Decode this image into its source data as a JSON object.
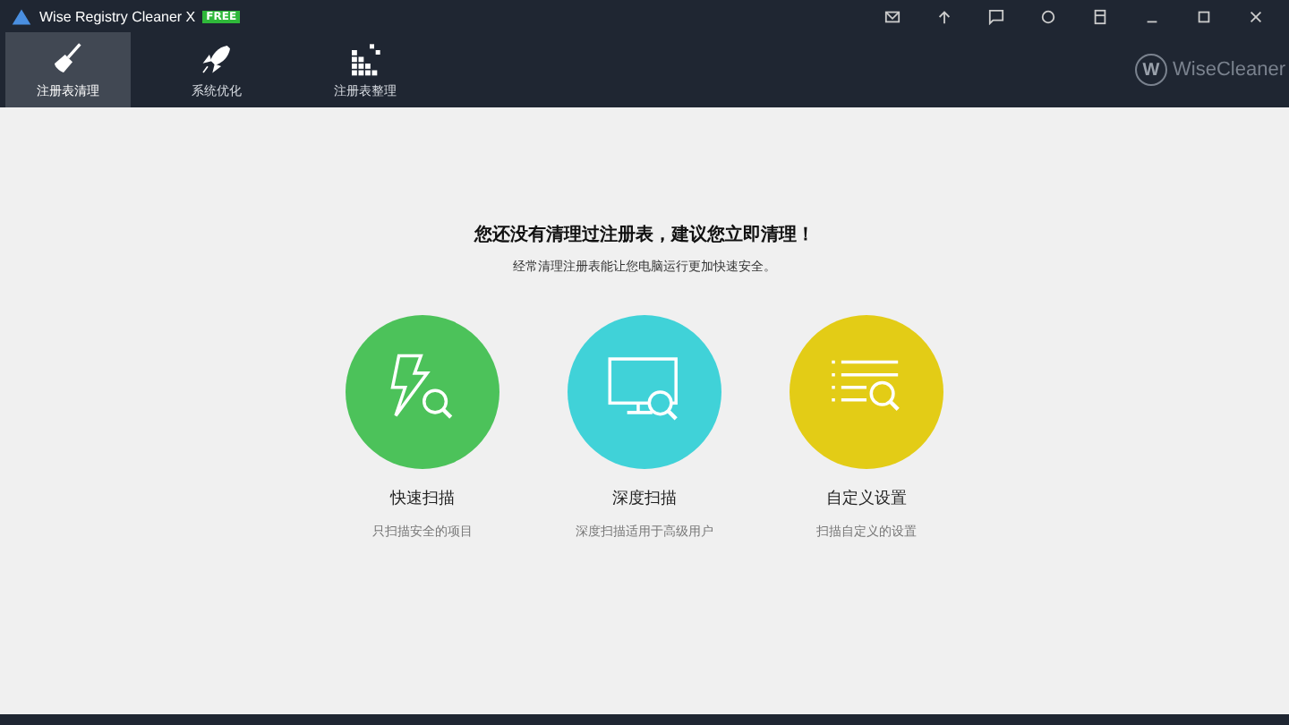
{
  "window": {
    "title": "Wise Registry Cleaner X",
    "badge": "FREE"
  },
  "tabs": [
    {
      "label": "注册表清理",
      "kind": "cleaner",
      "selected": true
    },
    {
      "label": "系统优化",
      "kind": "optimizer",
      "selected": false
    },
    {
      "label": "注册表整理",
      "kind": "defrag",
      "selected": false
    }
  ],
  "brand_mark": "W",
  "brand": "WiseCleaner",
  "headline": "您还没有清理过注册表，建议您立即清理！",
  "subline": "经常清理注册表能让您电脑运行更加快速安全。",
  "scan_options": [
    {
      "kind": "fast",
      "title": "快速扫描",
      "description": "只扫描安全的项目",
      "color": "#4cc25a"
    },
    {
      "kind": "deep",
      "title": "深度扫描",
      "description": "深度扫描适用于高级用户",
      "color": "#40d2d8"
    },
    {
      "kind": "custom",
      "title": "自定义设置",
      "description": "扫描自定义的设置",
      "color": "#e3cc16"
    }
  ]
}
